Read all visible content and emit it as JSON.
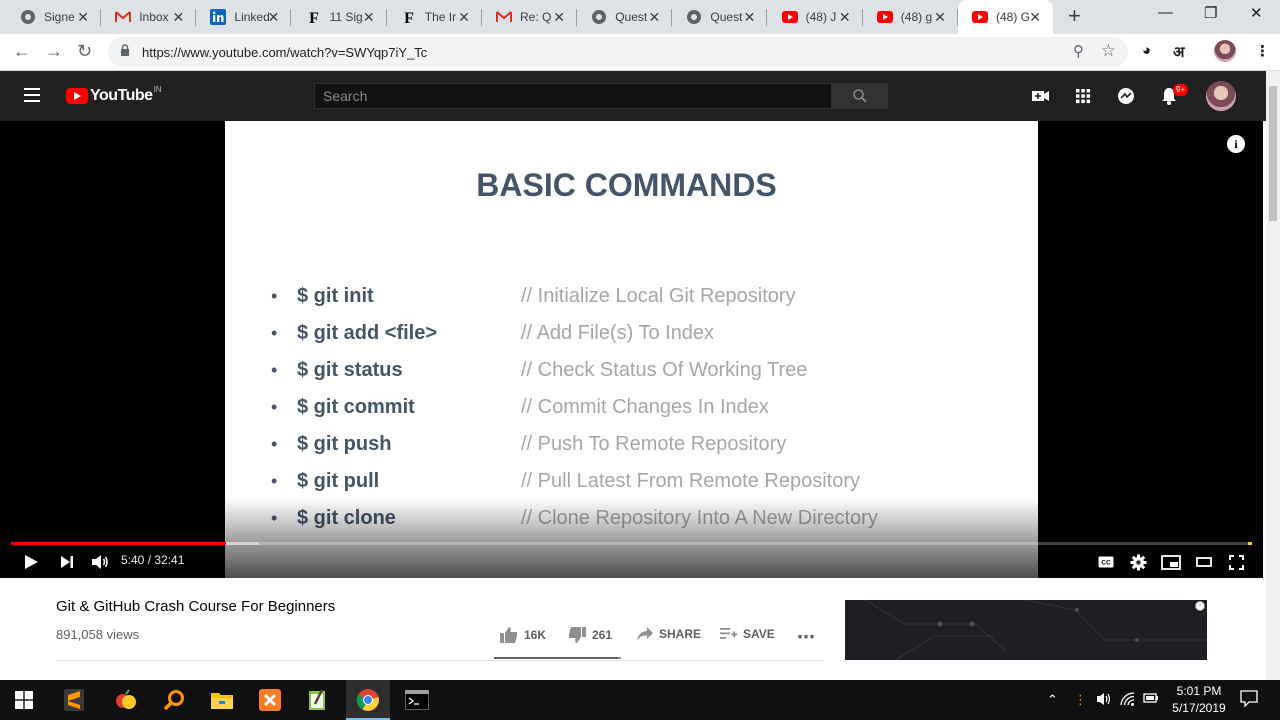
{
  "browser": {
    "tabs": [
      {
        "label": "Signe",
        "icon": "chrome-icon"
      },
      {
        "label": "Inbox",
        "icon": "gmail-icon"
      },
      {
        "label": "Linked",
        "icon": "linkedin-icon"
      },
      {
        "label": "11 Sig",
        "icon": "forbes-icon"
      },
      {
        "label": "The Ir",
        "icon": "forbes-icon"
      },
      {
        "label": "Re: Q",
        "icon": "gmail-icon"
      },
      {
        "label": "Quest",
        "icon": "chrome-icon"
      },
      {
        "label": "Quest",
        "icon": "chrome-icon"
      },
      {
        "label": "(48) J",
        "icon": "youtube-icon"
      },
      {
        "label": "(48) g",
        "icon": "youtube-icon"
      },
      {
        "label": "(48) G",
        "icon": "youtube-icon",
        "active": true
      }
    ],
    "url": "https://www.youtube.com/watch?v=SWYqp7iY_Tc",
    "extension_label": "अ"
  },
  "youtube": {
    "logo_text": "YouTube",
    "country_code": "IN",
    "search_placeholder": "Search",
    "notification_count": "9+"
  },
  "slide": {
    "title": "BASIC COMMANDS",
    "bullet": "•",
    "commands": [
      {
        "cmd": "$ git init",
        "desc": "// Initialize Local Git Repository"
      },
      {
        "cmd": "$ git add <file>",
        "desc": "// Add File(s) To Index"
      },
      {
        "cmd": "$ git status",
        "desc": "// Check Status Of Working Tree"
      },
      {
        "cmd": "$ git commit",
        "desc": "// Commit Changes In Index"
      },
      {
        "cmd": "$ git push",
        "desc": "// Push To Remote Repository"
      },
      {
        "cmd": "$ git pull",
        "desc": "// Pull Latest From Remote Repository"
      },
      {
        "cmd": "$ git clone",
        "desc": "// Clone Repository Into A New Directory"
      }
    ]
  },
  "player": {
    "current_time": "5:40",
    "duration": "32:41",
    "time_display": "5:40 / 32:41",
    "progress_fraction": 0.173,
    "buffered_fraction": 0.2
  },
  "video": {
    "title": "Git & GitHub Crash Course For Beginners",
    "views": "891,058 views",
    "likes": "16K",
    "dislikes": "261",
    "share_label": "SHARE",
    "save_label": "SAVE"
  },
  "taskbar": {
    "time": "5:01 PM",
    "date": "5/17/2019"
  },
  "colors": {
    "yt_red": "#ff0000",
    "slide_text": "#44546a",
    "slide_comment": "#a6a6a6"
  }
}
